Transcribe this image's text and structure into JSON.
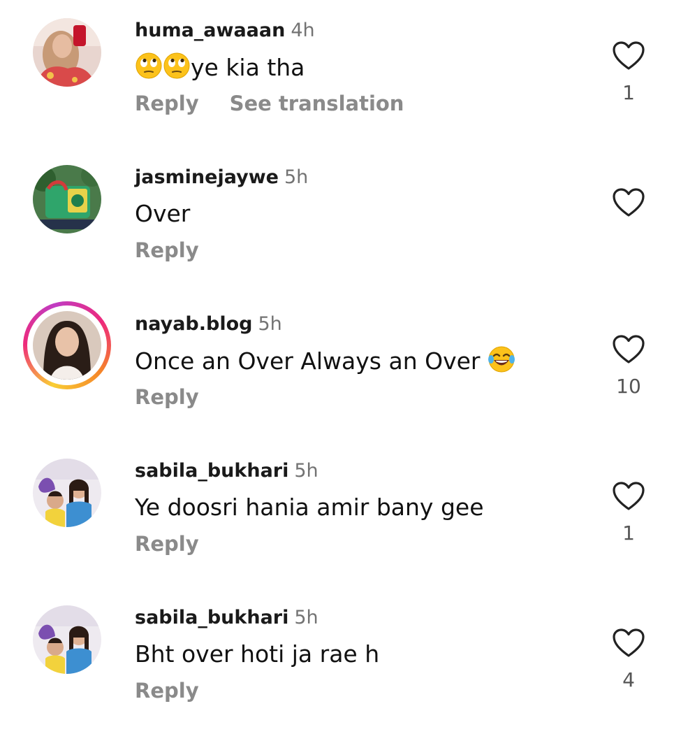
{
  "comments": [
    {
      "username": "huma_awaaan",
      "time": "4h",
      "text": "ye kia tha",
      "reply_label": "Reply",
      "translate_label": "See translation",
      "likes": "1",
      "emoji_before": "rolling-eyes-emoji x2"
    },
    {
      "username": "jasminejaywe",
      "time": "5h",
      "text": "Over",
      "reply_label": "Reply",
      "likes": ""
    },
    {
      "username": "nayab.blog",
      "time": "5h",
      "text": "Once an Over Always an Over",
      "reply_label": "Reply",
      "likes": "10",
      "emoji_after": "tears-of-joy-emoji",
      "has_story_ring": true
    },
    {
      "username": "sabila_bukhari",
      "time": "5h",
      "text": "Ye doosri hania amir bany gee",
      "reply_label": "Reply",
      "likes": "1"
    },
    {
      "username": "sabila_bukhari",
      "time": "5h",
      "text": "Bht over hoti ja rae h",
      "reply_label": "Reply",
      "likes": "4"
    }
  ],
  "colors": {
    "username": "#1a1a1a",
    "secondary_text": "#8a8a8a",
    "story_ring": "#ee2a7b"
  },
  "icons": {
    "like": "heart-outline-icon"
  }
}
